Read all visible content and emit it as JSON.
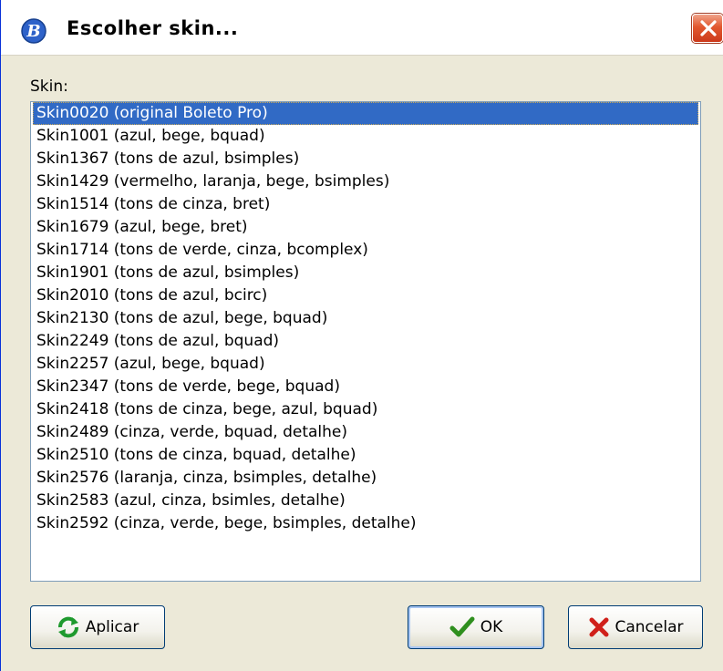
{
  "window": {
    "title": "Escolher skin...",
    "app_icon": "b-logo-icon",
    "close_icon": "close-icon"
  },
  "skin_label": "Skin:",
  "skins": [
    "Skin0020 (original Boleto Pro)",
    "Skin1001 (azul, bege, bquad)",
    "Skin1367 (tons de azul, bsimples)",
    "Skin1429 (vermelho, laranja, bege, bsimples)",
    "Skin1514 (tons de cinza, bret)",
    "Skin1679 (azul, bege, bret)",
    "Skin1714 (tons de verde, cinza, bcomplex)",
    "Skin1901 (tons de azul, bsimples)",
    "Skin2010 (tons de azul, bcirc)",
    "Skin2130 (tons de azul, bege, bquad)",
    "Skin2249 (tons de azul, bquad)",
    "Skin2257 (azul, bege, bquad)",
    "Skin2347 (tons de verde, bege, bquad)",
    "Skin2418 (tons de cinza, bege, azul, bquad)",
    "Skin2489 (cinza, verde, bquad, detalhe)",
    "Skin2510 (tons de cinza, bquad, detalhe)",
    "Skin2576 (laranja, cinza, bsimples, detalhe)",
    "Skin2583 (azul, cinza, bsimles, detalhe)",
    "Skin2592 (cinza, verde, bege, bsimples, detalhe)"
  ],
  "selected_index": 0,
  "buttons": {
    "apply": {
      "label": "Aplicar",
      "icon": "refresh-icon"
    },
    "ok": {
      "label": "OK",
      "icon": "checkmark-icon"
    },
    "cancel": {
      "label": "Cancelar",
      "icon": "x-icon"
    }
  },
  "colors": {
    "selection": "#316ac5",
    "dialog_bg": "#ece9d8",
    "close_button": "#e2582f"
  }
}
